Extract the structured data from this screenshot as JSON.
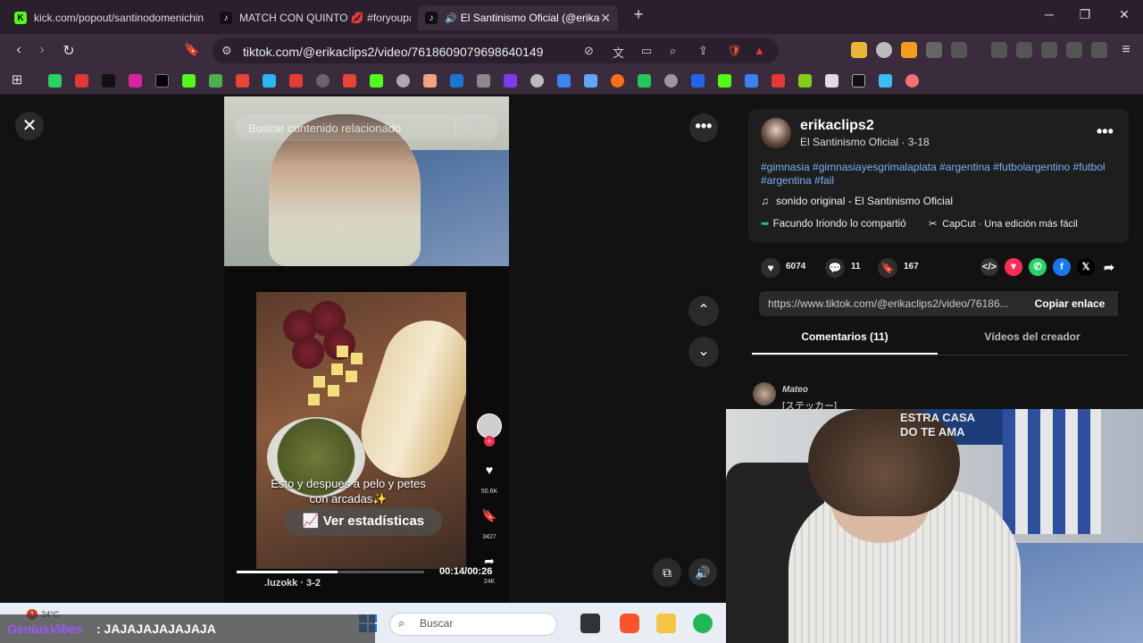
{
  "browser": {
    "tabs": [
      {
        "title": "kick.com/popout/santinodomenichin",
        "favicon": "kick-icon",
        "color": "#53fc18"
      },
      {
        "title": "MATCH CON QUINTO 💋 #foryoupag",
        "favicon": "tiktok-icon",
        "color": "#000000"
      },
      {
        "title": "El Santinismo Oficial (@erikac",
        "favicon": "tiktok-icon",
        "color": "#000000"
      }
    ],
    "new_tab": "+",
    "window": {
      "minimize": "─",
      "maximize": "❐",
      "close": "✕"
    },
    "url": "tiktok.com/@erikaclips2/video/7618609079698640149"
  },
  "video": {
    "search_placeholder": "Buscar contenido relacionado",
    "caption": "Esto y despues a pelo y petes con arcadas✨",
    "stats_button": "Ver estadísticas",
    "likes": "50.6K",
    "saves": "3427",
    "shares": "24K",
    "time": "00:14/00:26",
    "progress_fraction": 0.54,
    "author": ".luzokk · 3-2"
  },
  "panel": {
    "username": "erikaclips2",
    "subline": "El Santinismo Oficial · 3-18",
    "hashtags": "#gimnasia #gimnasiayesgrimalaplata #argentina #futbolargentino #futbol #argentina #fail",
    "sound": "sonido original - El Santinismo Oficial",
    "shared": "Facundo Iriondo lo compartió",
    "capcut": "CapCut · Una edición más fácil",
    "likes": "6074",
    "comments": "11",
    "saves": "167",
    "link": "https://www.tiktok.com/@erikaclips2/video/76186...",
    "copy_label": "Copiar enlace",
    "tab_comments": "Comentarios (11)",
    "tab_creator": "Vídeos del creador",
    "comment_user": "Mateo",
    "comment_text": "[ステッカー]"
  },
  "webcam": {
    "banner": "ESTRA CASA\nDO TE AMA"
  },
  "chat": {
    "user": "GeniusVibes",
    "message": ": JAJAJAJAJAJAJA"
  },
  "taskbar": {
    "weather": "24°C",
    "badge": "1",
    "search_placeholder": "Buscar"
  }
}
